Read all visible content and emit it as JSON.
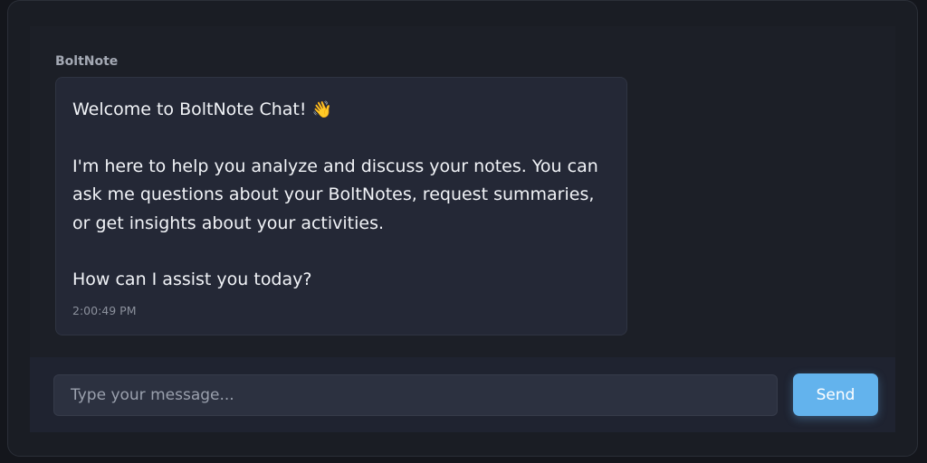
{
  "chat": {
    "sender": "BoltNote",
    "message": {
      "line1": "Welcome to BoltNote Chat!",
      "emoji": "👋",
      "para2": "I'm here to help you analyze and discuss your notes. You can ask me questions about your BoltNotes, request summaries, or get insights about your activities.",
      "para3": "How can I assist you today?",
      "timestamp": "2:00:49 PM"
    }
  },
  "input": {
    "placeholder": "Type your message...",
    "value": ""
  },
  "send_label": "Send",
  "colors": {
    "accent": "#63b3ed",
    "background": "#1a1d24",
    "bubble": "#242836"
  }
}
